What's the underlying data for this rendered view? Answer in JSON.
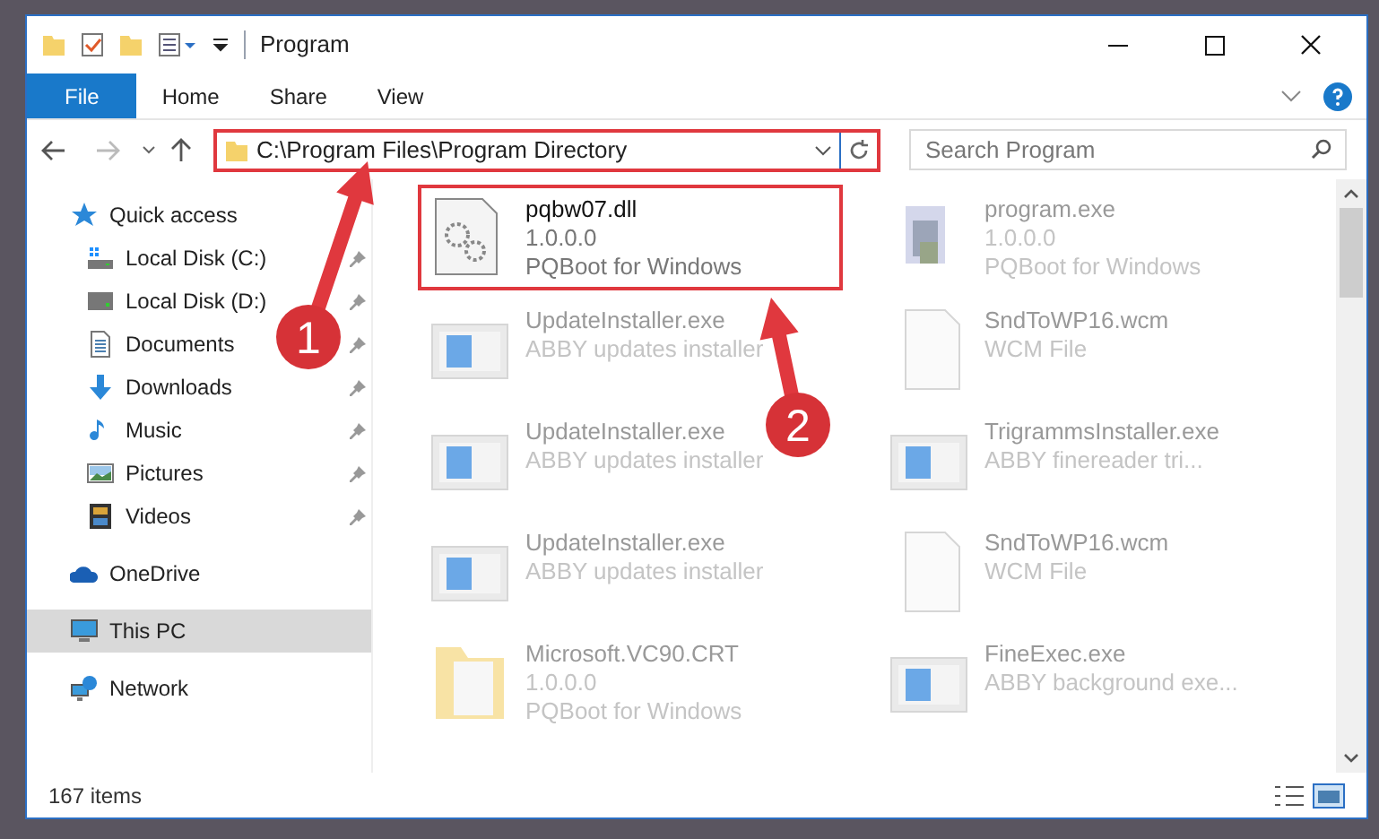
{
  "window": {
    "title": "Program"
  },
  "ribbon_tabs": [
    {
      "label": "File",
      "selected": true
    },
    {
      "label": "Home",
      "selected": false
    },
    {
      "label": "Share",
      "selected": false
    },
    {
      "label": "View",
      "selected": false
    }
  ],
  "address": {
    "path": "C:\\Program Files\\Program Directory"
  },
  "search": {
    "placeholder": "Search Program"
  },
  "sidebar": {
    "items": [
      {
        "label": "Quick access",
        "kind": "star",
        "selected": false,
        "children": [
          {
            "label": "Local Disk (C:)",
            "kind": "drive-system",
            "pinned": true,
            "selected": false
          },
          {
            "label": "Local Disk (D:)",
            "kind": "drive",
            "pinned": true,
            "selected": false
          },
          {
            "label": "Documents",
            "kind": "documents",
            "pinned": true,
            "selected": false
          },
          {
            "label": "Downloads",
            "kind": "download",
            "pinned": true,
            "selected": false
          },
          {
            "label": "Music",
            "kind": "music",
            "pinned": true,
            "selected": false
          },
          {
            "label": "Pictures",
            "kind": "pictures",
            "pinned": true,
            "selected": false
          },
          {
            "label": "Videos",
            "kind": "videos",
            "pinned": true,
            "selected": false
          }
        ]
      },
      {
        "label": "OneDrive",
        "kind": "cloud",
        "selected": false
      },
      {
        "label": "This PC",
        "kind": "computer",
        "selected": true
      },
      {
        "label": "Network",
        "kind": "network",
        "selected": false
      }
    ]
  },
  "files": [
    {
      "name": "pqbw07.dll",
      "details": [
        "1.0.0.0",
        "PQBoot for Windows"
      ],
      "kind": "dll",
      "highlighted": true
    },
    {
      "name": "program.exe",
      "details": [
        "1.0.0.0",
        "PQBoot for Windows"
      ],
      "kind": "app",
      "highlighted": false
    },
    {
      "name": "UpdateInstaller.exe",
      "details": [
        "ABBY updates installer"
      ],
      "kind": "installer",
      "highlighted": false
    },
    {
      "name": "SndToWP16.wcm",
      "details": [
        "WCM File"
      ],
      "kind": "document",
      "highlighted": false
    },
    {
      "name": "UpdateInstaller.exe",
      "details": [
        "ABBY updates installer"
      ],
      "kind": "installer",
      "highlighted": false
    },
    {
      "name": "TrigrammsInstaller.exe",
      "details": [
        "ABBY finereader tri..."
      ],
      "kind": "installer",
      "highlighted": false
    },
    {
      "name": "UpdateInstaller.exe",
      "details": [
        "ABBY updates installer"
      ],
      "kind": "installer",
      "highlighted": false
    },
    {
      "name": "SndToWP16.wcm",
      "details": [
        "WCM File"
      ],
      "kind": "document",
      "highlighted": false
    },
    {
      "name": "Microsoft.VC90.CRT",
      "details": [
        "1.0.0.0",
        "PQBoot for Windows"
      ],
      "kind": "folder",
      "highlighted": false
    },
    {
      "name": "FineExec.exe",
      "details": [
        "ABBY background exe..."
      ],
      "kind": "installer",
      "highlighted": false
    }
  ],
  "status_bar": {
    "item_count": "167 items"
  },
  "annotations": [
    {
      "number": "1"
    },
    {
      "number": "2"
    }
  ]
}
